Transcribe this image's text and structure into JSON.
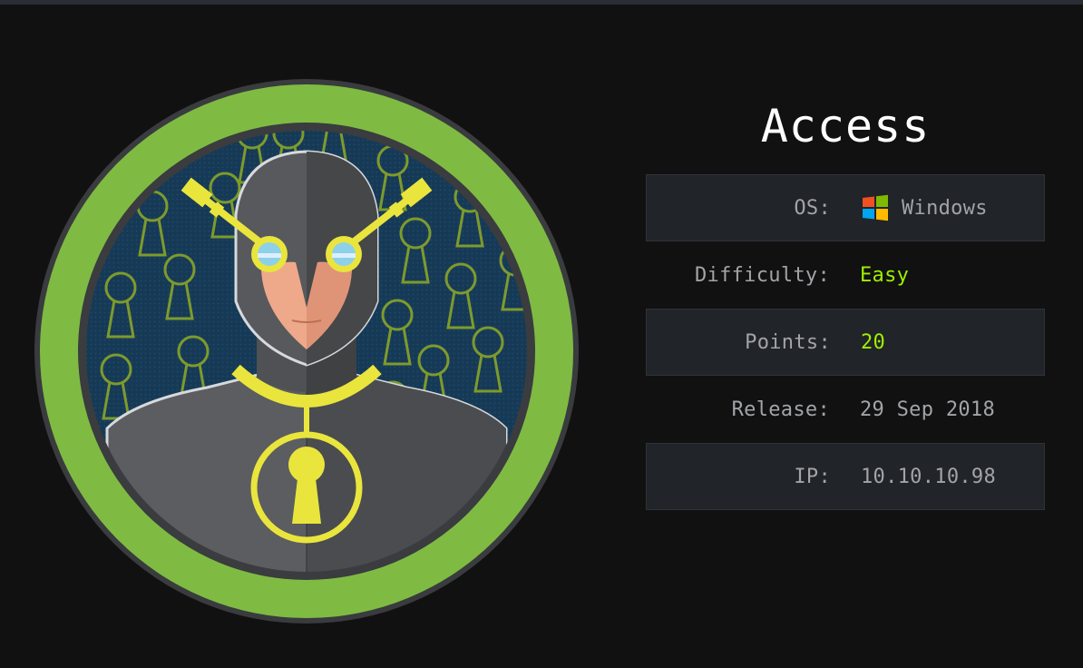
{
  "machine": {
    "name": "Access"
  },
  "info": {
    "os_label": "OS:",
    "os_value": "Windows",
    "os_icon": "windows-logo-icon",
    "difficulty_label": "Difficulty:",
    "difficulty_value": "Easy",
    "points_label": "Points:",
    "points_value": "20",
    "release_label": "Release:",
    "release_value": "29 Sep 2018",
    "ip_label": "IP:",
    "ip_value": "10.10.10.98"
  },
  "colors": {
    "background": "#111112",
    "accent_green": "#9fef00",
    "ring_green": "#7fbb43",
    "text_grey": "#a2a4a7",
    "row_shade": "#212428",
    "avatar_bg": "#163a56",
    "keyhole_outline": "#8ea431",
    "gold": "#e9e53d"
  }
}
